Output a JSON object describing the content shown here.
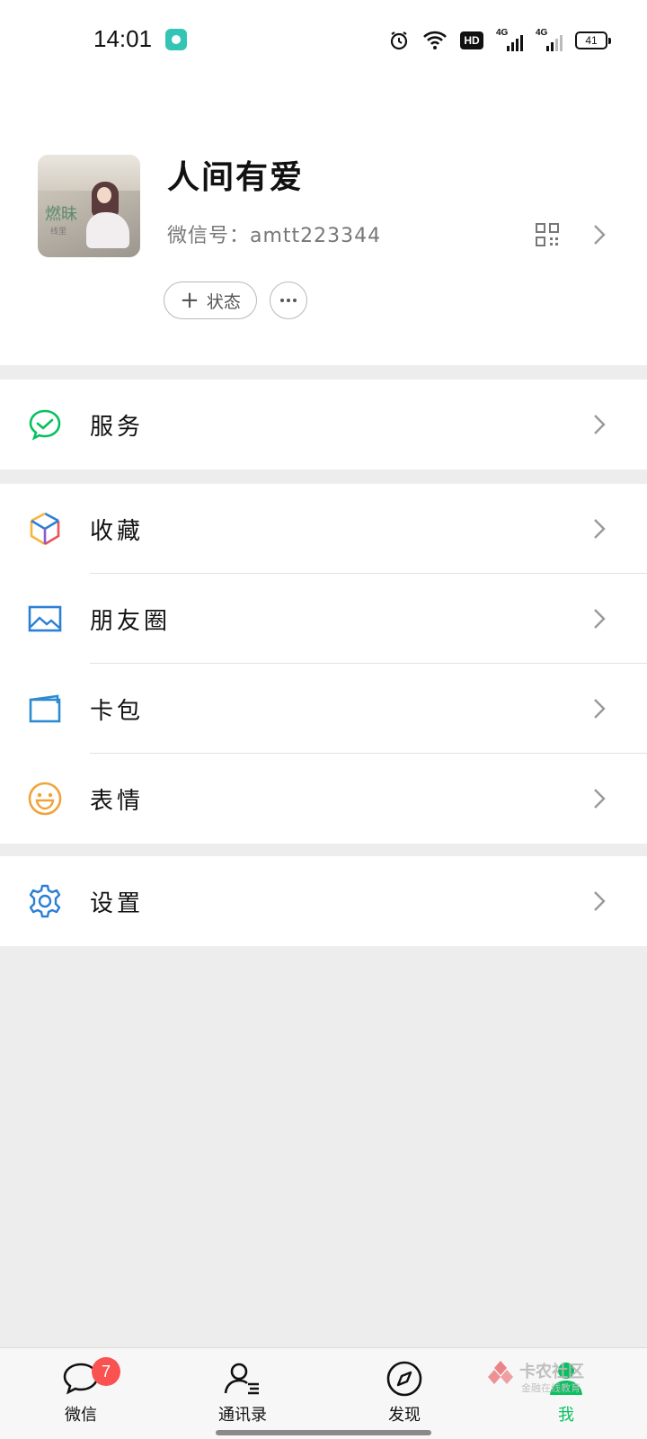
{
  "status_bar": {
    "time": "14:01",
    "hd_label": "HD",
    "network_label_1": "4G",
    "network_label_2": "4G",
    "battery_level": "41"
  },
  "profile": {
    "name": "人间有爱",
    "wechat_id_label": "微信号：amtt223344",
    "status_button_label": "状态",
    "avatar_text": "燃昧",
    "avatar_subtext": "线里"
  },
  "menu": {
    "group1": [
      {
        "label": "服务",
        "icon": "services-icon",
        "color": "#07c160"
      }
    ],
    "group2": [
      {
        "label": "收藏",
        "icon": "favorites-icon"
      },
      {
        "label": "朋友圈",
        "icon": "moments-icon",
        "color": "#2b7fd6"
      },
      {
        "label": "卡包",
        "icon": "card-wallet-icon",
        "color": "#2e8bd0"
      },
      {
        "label": "表情",
        "icon": "stickers-icon",
        "color": "#f0a33a"
      }
    ],
    "group3": [
      {
        "label": "设置",
        "icon": "settings-icon",
        "color": "#2b7fd6"
      }
    ]
  },
  "tabbar": {
    "tabs": [
      {
        "label": "微信",
        "icon": "chat-icon",
        "badge": "7"
      },
      {
        "label": "通讯录",
        "icon": "contacts-icon"
      },
      {
        "label": "发现",
        "icon": "discover-icon"
      },
      {
        "label": "我",
        "icon": "me-icon",
        "active": true
      }
    ],
    "active_color": "#07c160"
  },
  "watermark": {
    "title": "卡农社区",
    "subtitle": "金融在线教育"
  }
}
